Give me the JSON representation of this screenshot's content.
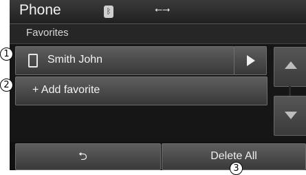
{
  "header": {
    "title": "Phone"
  },
  "status_icons": {
    "bluetooth": "bluetooth-icon",
    "usb": "usb-icon"
  },
  "subheader": {
    "title": "Favorites"
  },
  "list": [
    {
      "label": "Smith John",
      "icon": "phone-icon",
      "action_icon": "play-icon"
    },
    {
      "label": "+ Add favorite"
    }
  ],
  "footer": {
    "back_icon": "back-arrow-icon",
    "delete_label": "Delete All"
  },
  "callouts": [
    "1",
    "2",
    "3"
  ]
}
